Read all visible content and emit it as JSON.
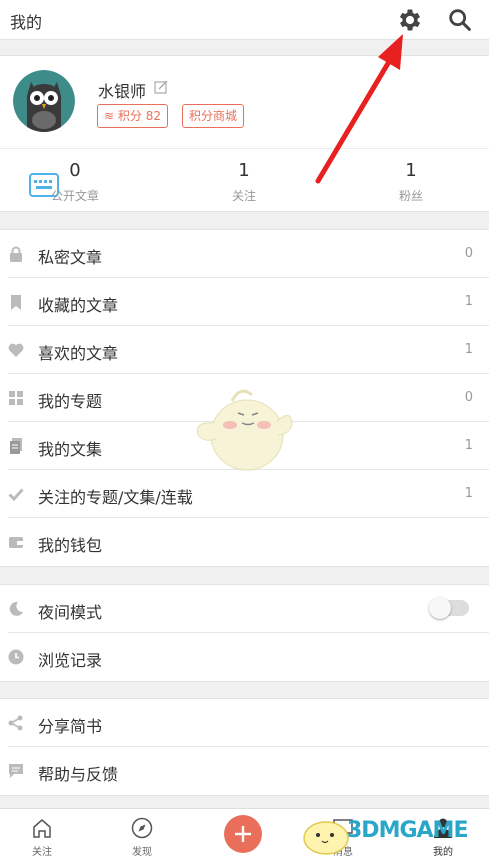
{
  "header": {
    "title": "我的"
  },
  "profile": {
    "username": "水银师",
    "points_badge": "积分 82",
    "shop_badge": "积分商城",
    "stats": [
      {
        "value": "0",
        "label": "公开文章"
      },
      {
        "value": "1",
        "label": "关注"
      },
      {
        "value": "1",
        "label": "粉丝"
      }
    ]
  },
  "menu1": [
    {
      "label": "私密文章",
      "count": "0",
      "icon": "lock-icon"
    },
    {
      "label": "收藏的文章",
      "count": "1",
      "icon": "bookmark-icon"
    },
    {
      "label": "喜欢的文章",
      "count": "1",
      "icon": "heart-icon"
    },
    {
      "label": "我的专题",
      "count": "0",
      "icon": "grid-icon"
    },
    {
      "label": "我的文集",
      "count": "1",
      "icon": "notebook-icon"
    },
    {
      "label": "关注的专题/文集/连载",
      "count": "1",
      "icon": "check-icon"
    },
    {
      "label": "我的钱包",
      "count": "",
      "icon": "wallet-icon"
    }
  ],
  "menu2": [
    {
      "label": "夜间模式",
      "icon": "moon-icon",
      "toggle": "off"
    },
    {
      "label": "浏览记录",
      "icon": "clock-icon"
    }
  ],
  "menu3": [
    {
      "label": "分享简书",
      "icon": "share-icon"
    },
    {
      "label": "帮助与反馈",
      "icon": "feedback-icon"
    }
  ],
  "tabbar": [
    {
      "label": "关注",
      "icon": "home-icon"
    },
    {
      "label": "发现",
      "icon": "compass-icon"
    },
    {
      "label": "消息",
      "icon": "message-icon"
    },
    {
      "label": "我的",
      "icon": "person-icon"
    }
  ],
  "watermark": "3DMGAME",
  "colors": {
    "accent": "#ea6f5a",
    "arrow": "#e8201f",
    "watermark": "#2aa6c9"
  }
}
